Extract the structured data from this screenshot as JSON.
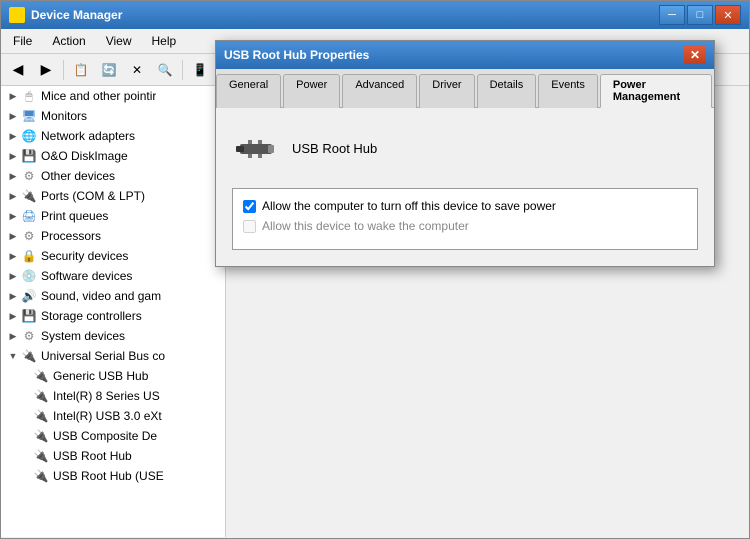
{
  "device_manager": {
    "title": "Device Manager",
    "menu": [
      "File",
      "Action",
      "View",
      "Help"
    ],
    "tree_items": [
      {
        "level": 1,
        "label": "Mice and other pointir",
        "icon": "🖱",
        "expanded": false
      },
      {
        "level": 1,
        "label": "Monitors",
        "icon": "🖥",
        "expanded": false
      },
      {
        "level": 1,
        "label": "Network adapters",
        "icon": "🌐",
        "expanded": false
      },
      {
        "level": 1,
        "label": "O&O DiskImage",
        "icon": "💾",
        "expanded": false
      },
      {
        "level": 1,
        "label": "Other devices",
        "icon": "⚙",
        "expanded": false
      },
      {
        "level": 1,
        "label": "Ports (COM & LPT)",
        "icon": "🔌",
        "expanded": false
      },
      {
        "level": 1,
        "label": "Print queues",
        "icon": "🖨",
        "expanded": false
      },
      {
        "level": 1,
        "label": "Processors",
        "icon": "⚙",
        "expanded": false
      },
      {
        "level": 1,
        "label": "Security devices",
        "icon": "🔒",
        "expanded": false
      },
      {
        "level": 1,
        "label": "Software devices",
        "icon": "💿",
        "expanded": false
      },
      {
        "level": 1,
        "label": "Sound, video and gam",
        "icon": "🔊",
        "expanded": false
      },
      {
        "level": 1,
        "label": "Storage controllers",
        "icon": "💾",
        "expanded": false
      },
      {
        "level": 1,
        "label": "System devices",
        "icon": "⚙",
        "expanded": false
      },
      {
        "level": 1,
        "label": "Universal Serial Bus co",
        "icon": "🔌",
        "expanded": true
      },
      {
        "level": 2,
        "label": "Generic USB Hub",
        "icon": "🔌"
      },
      {
        "level": 2,
        "label": "Intel(R) 8 Series US",
        "icon": "🔌"
      },
      {
        "level": 2,
        "label": "Intel(R) USB 3.0 eXt",
        "icon": "🔌"
      },
      {
        "level": 2,
        "label": "USB Composite De",
        "icon": "🔌"
      },
      {
        "level": 2,
        "label": "USB Root Hub",
        "icon": "🔌"
      },
      {
        "level": 2,
        "label": "USB Root Hub (USE",
        "icon": "🔌"
      }
    ]
  },
  "dialog": {
    "title": "USB Root Hub Properties",
    "device_name": "USB Root Hub",
    "tabs": [
      "General",
      "Power",
      "Advanced",
      "Driver",
      "Details",
      "Events",
      "Power Management"
    ],
    "active_tab": "Power Management",
    "checkbox1_label": "Allow the computer to turn off this device to save power",
    "checkbox1_checked": true,
    "checkbox2_label": "Allow this device to wake the computer",
    "checkbox2_checked": false,
    "checkbox2_disabled": true
  },
  "toolbar": {
    "back_label": "◀",
    "forward_label": "▶",
    "up_label": "⬆"
  }
}
